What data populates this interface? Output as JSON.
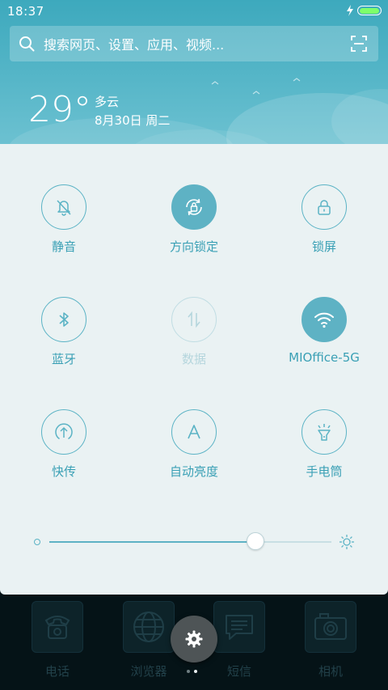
{
  "status_bar": {
    "time": "18:37",
    "battery_level": 1.0
  },
  "search": {
    "placeholder": "搜索网页、设置、应用、视频..."
  },
  "weather": {
    "temperature": "29°",
    "condition": "多云",
    "date": "8月30日 周二"
  },
  "toggles": [
    {
      "label": "静音",
      "icon": "bell-off-icon",
      "state": "off"
    },
    {
      "label": "方向锁定",
      "icon": "rotation-lock-icon",
      "state": "on"
    },
    {
      "label": "锁屏",
      "icon": "lock-icon",
      "state": "off"
    },
    {
      "label": "蓝牙",
      "icon": "bluetooth-icon",
      "state": "off"
    },
    {
      "label": "数据",
      "icon": "mobile-data-icon",
      "state": "disabled"
    },
    {
      "label": "MIOffice-5G",
      "icon": "wifi-icon",
      "state": "on"
    },
    {
      "label": "快传",
      "icon": "quick-transfer-icon",
      "state": "off"
    },
    {
      "label": "自动亮度",
      "icon": "auto-brightness-icon",
      "state": "off"
    },
    {
      "label": "手电筒",
      "icon": "flashlight-icon",
      "state": "off"
    }
  ],
  "brightness": {
    "level": 0.73
  },
  "dock": {
    "apps": [
      {
        "label": "电话",
        "icon": "phone-icon"
      },
      {
        "label": "浏览器",
        "icon": "browser-icon"
      },
      {
        "label": "短信",
        "icon": "messages-icon"
      },
      {
        "label": "相机",
        "icon": "camera-icon"
      }
    ],
    "page_indicator": {
      "count": 2,
      "active": 2
    }
  },
  "colors": {
    "accent": "#5eb2c4",
    "header_top": "#3da9bd",
    "panel_bg": "#eaf2f3",
    "label": "#3aa0b5",
    "disabled": "#b5d6dd",
    "dock_bg": "#051317"
  }
}
